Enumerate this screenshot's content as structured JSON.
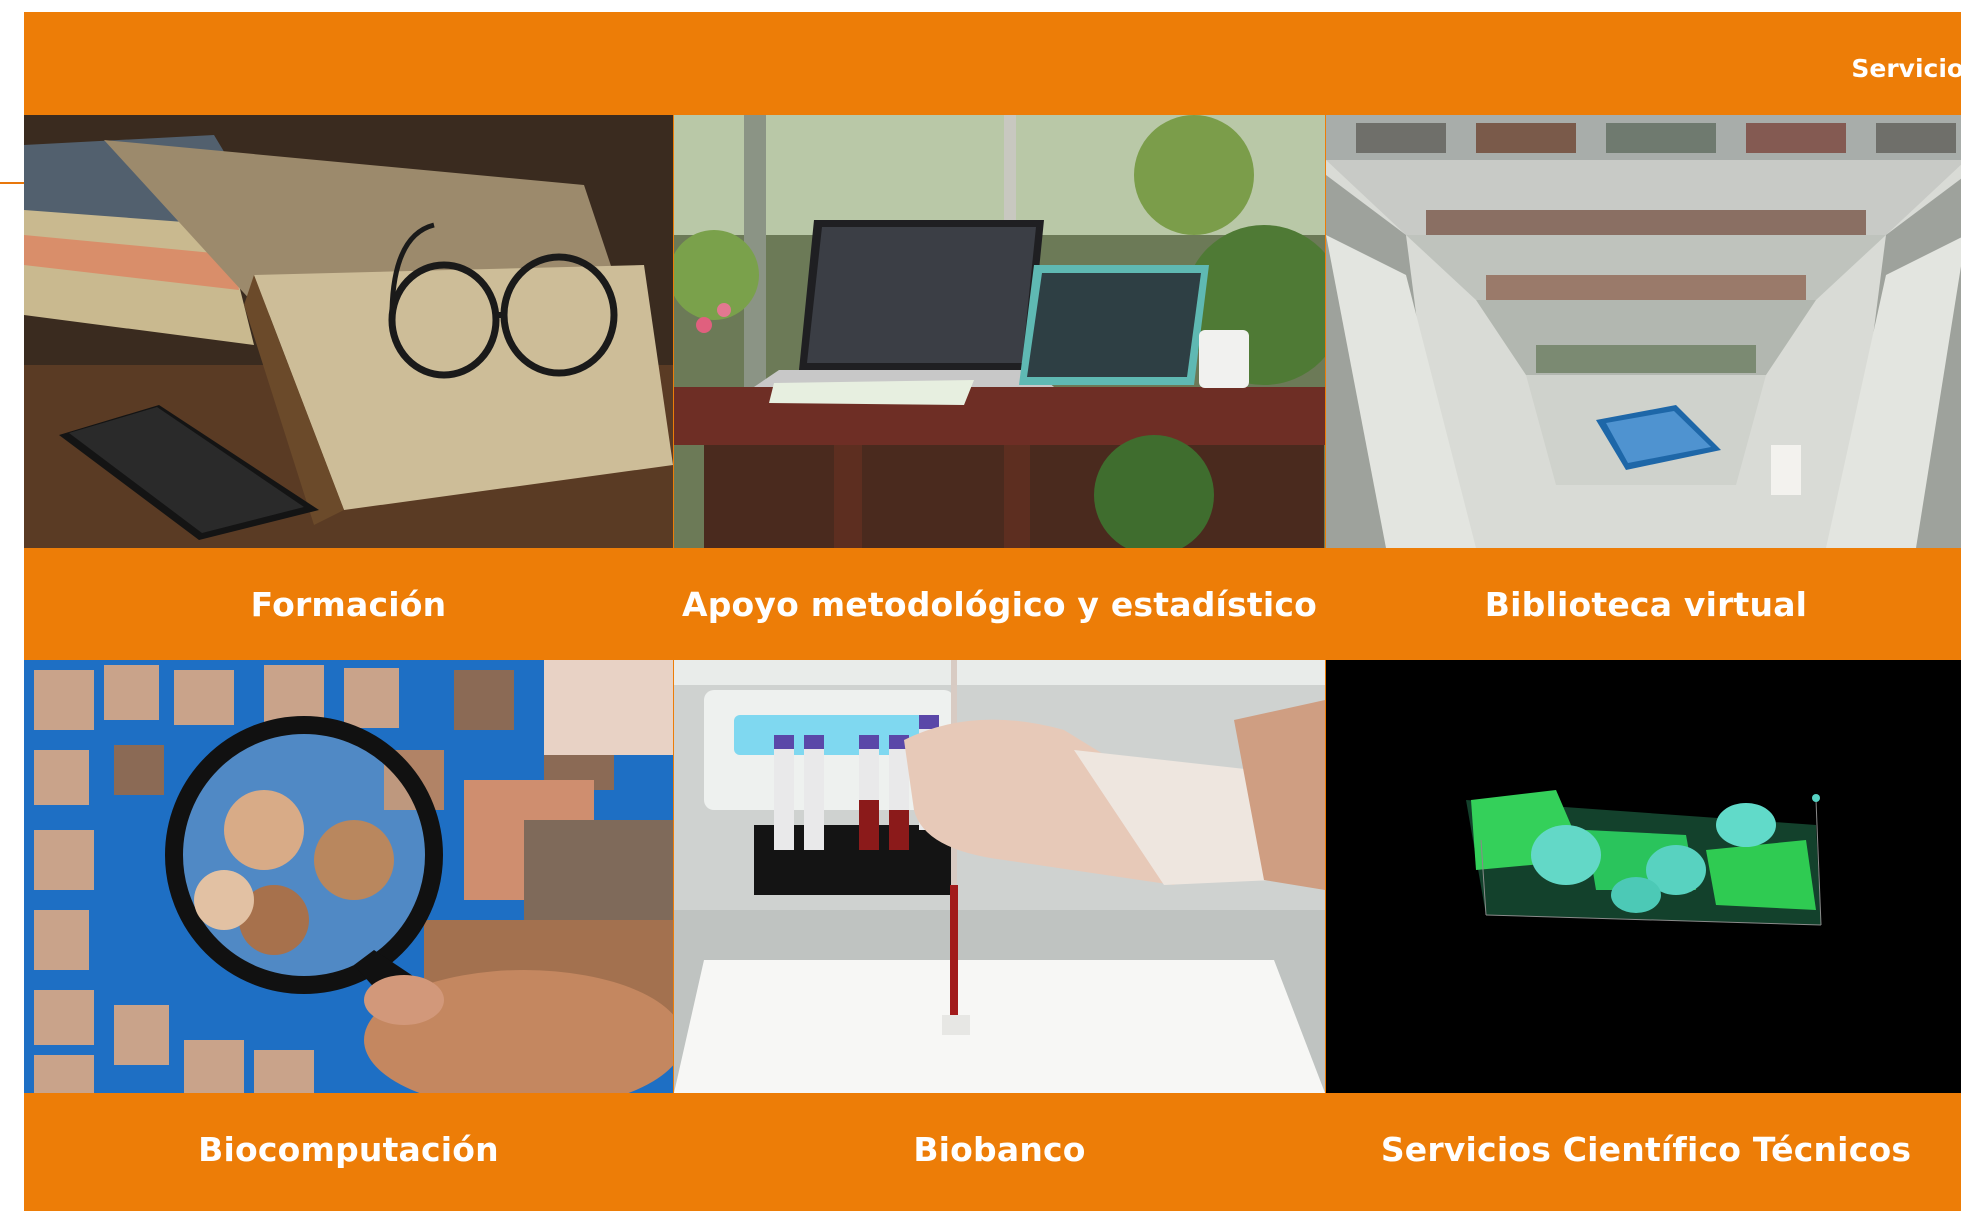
{
  "header": {
    "services_link": "Servicios"
  },
  "tiles": [
    {
      "label": "Formación"
    },
    {
      "label": "Apoyo metodológico y estadístico"
    },
    {
      "label": "Biblioteca virtual"
    },
    {
      "label": "Biocomputación"
    },
    {
      "label": "Biobanco"
    },
    {
      "label": "Servicios Científico Técnicos"
    }
  ],
  "colors": {
    "brand_orange": "#ed7d07",
    "text": "#ffffff"
  }
}
